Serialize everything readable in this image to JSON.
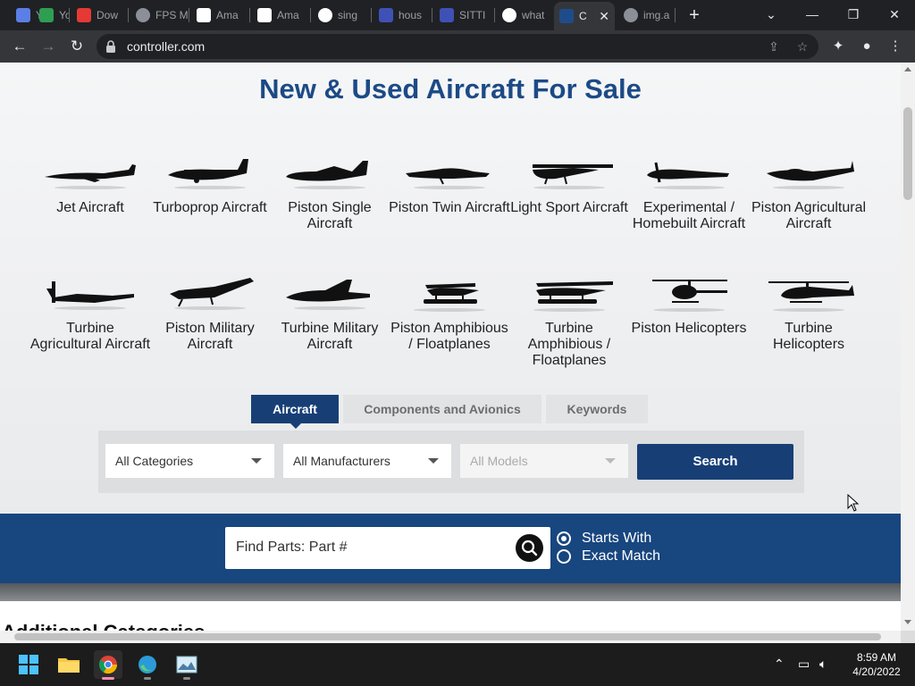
{
  "browser": {
    "tabs": [
      {
        "label": "Yo",
        "icon": "mail-icon",
        "color": "#5b7fe6"
      },
      {
        "label": "Yo",
        "icon": "check-icon",
        "color": "#2e9e52"
      },
      {
        "label": "Dow",
        "icon": "arrow-icon",
        "color": "#e53935"
      },
      {
        "label": "FPS M",
        "icon": "globe-icon",
        "color": "#8a8f98"
      },
      {
        "label": "Ama",
        "icon": "amazon-icon",
        "color": "#ffffff"
      },
      {
        "label": "Ama",
        "icon": "amazon-icon",
        "color": "#ffffff"
      },
      {
        "label": "sing",
        "icon": "google-icon",
        "color": "#ffffff"
      },
      {
        "label": "hous",
        "icon": "doc-icon",
        "color": "#3f51b5"
      },
      {
        "label": "SITTI",
        "icon": "doc-icon",
        "color": "#3f51b5"
      },
      {
        "label": "what",
        "icon": "google-icon",
        "color": "#ffffff"
      },
      {
        "label": "C",
        "icon": "controller-icon",
        "color": "#1e4c8a",
        "active": true
      },
      {
        "label": "img.a",
        "icon": "globe-icon",
        "color": "#8a8f98"
      }
    ],
    "url": "controller.com"
  },
  "page": {
    "title": "New & Used Aircraft For Sale",
    "categories_row1": [
      {
        "label": "Jet Aircraft"
      },
      {
        "label": "Turboprop Aircraft"
      },
      {
        "label": "Piston Single Aircraft"
      },
      {
        "label": "Piston Twin Aircraft"
      },
      {
        "label": "Light Sport Aircraft"
      },
      {
        "label": "Experimental / Homebuilt Aircraft"
      },
      {
        "label": "Piston Agricultural Aircraft"
      }
    ],
    "categories_row2": [
      {
        "label": "Turbine Agricultural Aircraft"
      },
      {
        "label": "Piston Military Aircraft"
      },
      {
        "label": "Turbine Military Aircraft"
      },
      {
        "label": "Piston Amphibious / Floatplanes"
      },
      {
        "label": "Turbine Amphibious / Floatplanes"
      },
      {
        "label": "Piston Helicopters"
      },
      {
        "label": "Turbine Helicopters"
      }
    ],
    "search_tabs": [
      {
        "label": "Aircraft",
        "active": true
      },
      {
        "label": "Components and Avionics"
      },
      {
        "label": "Keywords"
      }
    ],
    "filters": {
      "category": "All Categories",
      "manufacturer": "All Manufacturers",
      "model": "All Models",
      "search_label": "Search"
    },
    "parts": {
      "placeholder": "Find Parts: Part #",
      "options": [
        {
          "label": "Starts With",
          "selected": true
        },
        {
          "label": "Exact Match",
          "selected": false
        }
      ]
    },
    "additional_heading": "Additional Categories"
  },
  "taskbar": {
    "time": "8:59 AM",
    "date": "4/20/2022"
  },
  "colors": {
    "brand_blue": "#1c4a86",
    "band_blue": "#18467f",
    "tab_active": "#173f76"
  }
}
